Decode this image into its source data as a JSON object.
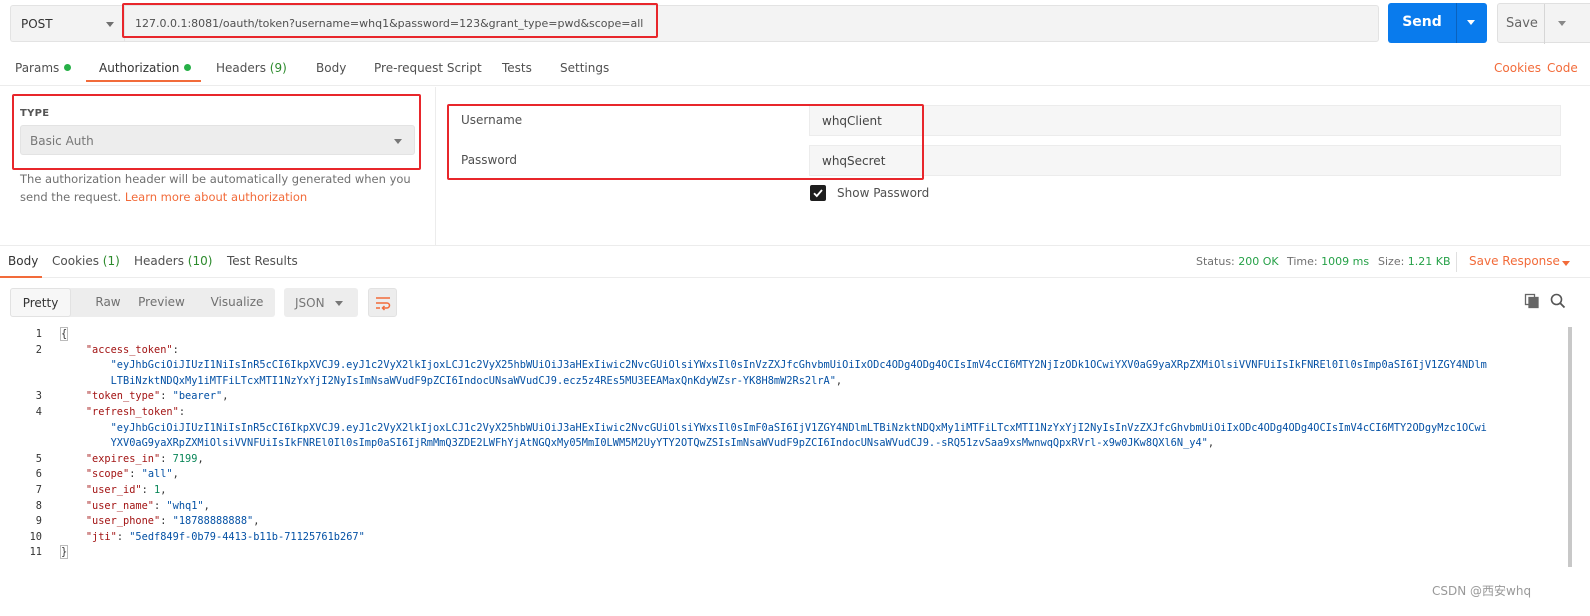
{
  "request": {
    "method": "POST",
    "url": "127.0.0.1:8081/oauth/token?username=whq1&password=123&grant_type=pwd&scope=all",
    "send_label": "Send",
    "save_label": "Save"
  },
  "request_tabs": [
    {
      "label": "Params",
      "dot": true
    },
    {
      "label": "Authorization",
      "dot": true
    },
    {
      "label": "Headers ",
      "count": "(9)"
    },
    {
      "label": "Body"
    },
    {
      "label": "Pre-request Script"
    },
    {
      "label": "Tests"
    },
    {
      "label": "Settings"
    }
  ],
  "right_links": {
    "cookies": "Cookies",
    "code": "Code"
  },
  "auth": {
    "type_label": "TYPE",
    "type_value": "Basic Auth",
    "help_text": "The authorization header will be automatically generated when you send the request. ",
    "help_link": "Learn more about authorization",
    "username_label": "Username",
    "username_value": "whqClient",
    "password_label": "Password",
    "password_value": "whqSecret",
    "show_password_label": "Show Password",
    "show_password_checked": true
  },
  "response_tabs": [
    {
      "label": "Body"
    },
    {
      "label": "Cookies ",
      "count": "(1)"
    },
    {
      "label": "Headers ",
      "count": "(10)"
    },
    {
      "label": "Test Results"
    }
  ],
  "status": {
    "status_label": "Status:",
    "status_value": "200 OK",
    "time_label": "Time:",
    "time_value": "1009 ms",
    "size_label": "Size:",
    "size_value": "1.21 KB",
    "save_response": "Save Response"
  },
  "view_modes": [
    "Pretty",
    "Raw",
    "Preview",
    "Visualize"
  ],
  "format": "JSON",
  "code_lines": [
    {
      "n": "1",
      "parts": [
        [
          "b",
          "{"
        ]
      ]
    },
    {
      "n": "2",
      "parts": [
        [
          "p",
          "    "
        ],
        [
          "k",
          "\"access_token\""
        ],
        [
          "p",
          ":"
        ]
      ]
    },
    {
      "n": "",
      "parts": [
        [
          "p",
          "        "
        ],
        [
          "s",
          "\"eyJhbGciOiJIUzI1NiIsInR5cCI6IkpXVCJ9.eyJ1c2VyX2lkIjoxLCJ1c2VyX25hbWUiOiJ3aHExIiwic2NvcGUiOlsiYWxsIl0sInVzZXJfcGhvbmUiOiIxODc4ODg4ODg4OCIsImV4cCI6MTY2NjIzODk1OCwiYXV0aG9yaXRpZXMiOlsiVVNFUiIsIkFNREl0Il0sImp0aSI6IjV1ZGY4NDlm"
        ]
      ]
    },
    {
      "n": "",
      "parts": [
        [
          "p",
          "        "
        ],
        [
          "s",
          "LTBiNzktNDQxMy1iMTFiLTcxMTI1NzYxYjI2NyIsImNsaWVudF9pZCI6IndocUNsaWVudCJ9.ecz5z4REs5MU3EEAMaxQnKdyWZsr-YK8H8mW2Rs2lrA\""
        ],
        [
          "p",
          ","
        ]
      ]
    },
    {
      "n": "3",
      "parts": [
        [
          "p",
          "    "
        ],
        [
          "k",
          "\"token_type\""
        ],
        [
          "p",
          ": "
        ],
        [
          "s",
          "\"bearer\""
        ],
        [
          "p",
          ","
        ]
      ]
    },
    {
      "n": "4",
      "parts": [
        [
          "p",
          "    "
        ],
        [
          "k",
          "\"refresh_token\""
        ],
        [
          "p",
          ":"
        ]
      ]
    },
    {
      "n": "",
      "parts": [
        [
          "p",
          "        "
        ],
        [
          "s",
          "\"eyJhbGciOiJIUzI1NiIsInR5cCI6IkpXVCJ9.eyJ1c2VyX2lkIjoxLCJ1c2VyX25hbWUiOiJ3aHExIiwic2NvcGUiOlsiYWxsIl0sImF0aSI6IjV1ZGY4NDlmLTBiNzktNDQxMy1iMTFiLTcxMTI1NzYxYjI2NyIsInVzZXJfcGhvbmUiOiIxODc4ODg4ODg4OCIsImV4cCI6MTY2ODgyMzc1OCwi"
        ]
      ]
    },
    {
      "n": "",
      "parts": [
        [
          "p",
          "        "
        ],
        [
          "s",
          "YXV0aG9yaXRpZXMiOlsiVVNFUiIsIkFNREl0Il0sImp0aSI6IjRmMmQ3ZDE2LWFhYjAtNGQxMy05MmI0LWM5M2UyYTY2OTQwZSIsImNsaWVudF9pZCI6IndocUNsaWVudCJ9.-sRQ51zvSaa9xsMwnwqQpxRVrl-x9w0JKw8QXl6N_y4\""
        ],
        [
          "p",
          ","
        ]
      ]
    },
    {
      "n": "5",
      "parts": [
        [
          "p",
          "    "
        ],
        [
          "k",
          "\"expires_in\""
        ],
        [
          "p",
          ": "
        ],
        [
          "n",
          "7199"
        ],
        [
          "p",
          ","
        ]
      ]
    },
    {
      "n": "6",
      "parts": [
        [
          "p",
          "    "
        ],
        [
          "k",
          "\"scope\""
        ],
        [
          "p",
          ": "
        ],
        [
          "s",
          "\"all\""
        ],
        [
          "p",
          ","
        ]
      ]
    },
    {
      "n": "7",
      "parts": [
        [
          "p",
          "    "
        ],
        [
          "k",
          "\"user_id\""
        ],
        [
          "p",
          ": "
        ],
        [
          "n",
          "1"
        ],
        [
          "p",
          ","
        ]
      ]
    },
    {
      "n": "8",
      "parts": [
        [
          "p",
          "    "
        ],
        [
          "k",
          "\"user_name\""
        ],
        [
          "p",
          ": "
        ],
        [
          "s",
          "\"whq1\""
        ],
        [
          "p",
          ","
        ]
      ]
    },
    {
      "n": "9",
      "parts": [
        [
          "p",
          "    "
        ],
        [
          "k",
          "\"user_phone\""
        ],
        [
          "p",
          ": "
        ],
        [
          "s",
          "\"18788888888\""
        ],
        [
          "p",
          ","
        ]
      ]
    },
    {
      "n": "10",
      "parts": [
        [
          "p",
          "    "
        ],
        [
          "k",
          "\"jti\""
        ],
        [
          "p",
          ": "
        ],
        [
          "s",
          "\"5edf849f-0b79-4413-b11b-71125761b267\""
        ]
      ]
    },
    {
      "n": "11",
      "parts": [
        [
          "b",
          "}"
        ]
      ]
    }
  ],
  "watermark": "CSDN @西安whq",
  "colors": {
    "accent": "#f26b3a",
    "send": "#097bed",
    "annotation": "#e8262b",
    "status_ok": "#26a148"
  }
}
